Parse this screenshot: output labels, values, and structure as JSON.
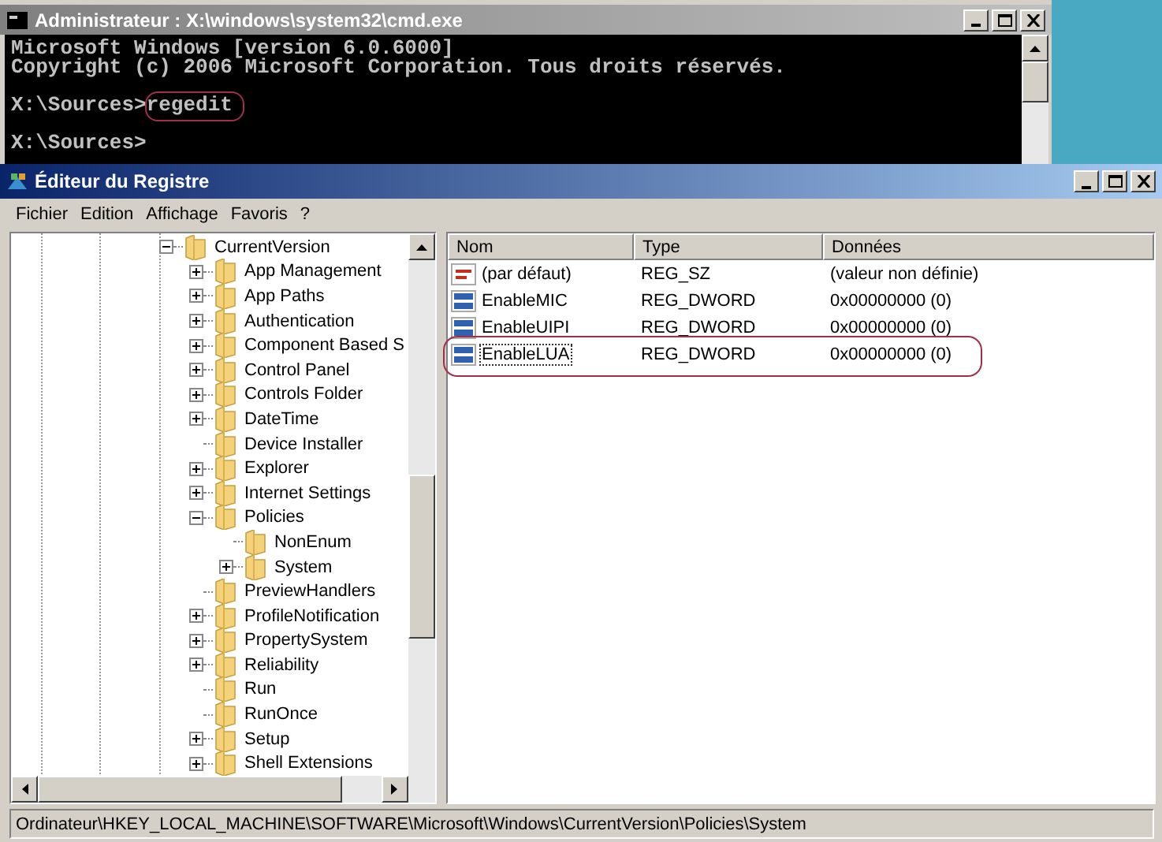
{
  "console_window": {
    "title": "Administrateur : X:\\windows\\system32\\cmd.exe",
    "active": false,
    "lines": [
      {
        "text": "Microsoft Windows [version 6.0.6000]",
        "gap_before": false
      },
      {
        "text": "Copyright (c) 2006 Microsoft Corporation. Tous droits réservés.",
        "gap_before": false
      },
      {
        "text": "X:\\Sources>",
        "command": "regedit",
        "circled": true,
        "gap_before": true
      },
      {
        "text": "X:\\Sources>",
        "gap_before": true
      }
    ]
  },
  "registry_window": {
    "title": "Éditeur du Registre",
    "active": true,
    "menu": [
      "Fichier",
      "Edition",
      "Affichage",
      "Favoris",
      "?"
    ],
    "tree": [
      {
        "label": "CurrentVersion",
        "expandable": true,
        "children": [
          {
            "label": "App Management",
            "expandable": true
          },
          {
            "label": "App Paths",
            "expandable": true
          },
          {
            "label": "Authentication",
            "expandable": true
          },
          {
            "label": "Component Based S",
            "expandable": true
          },
          {
            "label": "Control Panel",
            "expandable": true
          },
          {
            "label": "Controls Folder",
            "expandable": true
          },
          {
            "label": "DateTime",
            "expandable": true
          },
          {
            "label": "Device Installer",
            "expandable": false
          },
          {
            "label": "Explorer",
            "expandable": true
          },
          {
            "label": "Internet Settings",
            "expandable": true
          },
          {
            "label": "Policies",
            "expandable": true,
            "children": [
              {
                "label": "NonEnum",
                "expandable": false
              },
              {
                "label": "System",
                "expandable": true
              }
            ]
          },
          {
            "label": "PreviewHandlers",
            "expandable": false
          },
          {
            "label": "ProfileNotification",
            "expandable": true
          },
          {
            "label": "PropertySystem",
            "expandable": true
          },
          {
            "label": "Reliability",
            "expandable": true
          },
          {
            "label": "Run",
            "expandable": false
          },
          {
            "label": "RunOnce",
            "expandable": false
          },
          {
            "label": "Setup",
            "expandable": true
          },
          {
            "label": "Shell Extensions",
            "expandable": true
          }
        ]
      }
    ],
    "columns": [
      "Nom",
      "Type",
      "Données"
    ],
    "values": [
      {
        "kind": "string",
        "name": "(par défaut)",
        "type": "REG_SZ",
        "data": "(valeur non définie)",
        "focused": false,
        "circled": false
      },
      {
        "kind": "dword",
        "name": "EnableMIC",
        "type": "REG_DWORD",
        "data": "0x00000000 (0)",
        "focused": false,
        "circled": false
      },
      {
        "kind": "dword",
        "name": "EnableUIPI",
        "type": "REG_DWORD",
        "data": "0x00000000 (0)",
        "focused": false,
        "circled": false
      },
      {
        "kind": "dword",
        "name": "EnableLUA",
        "type": "REG_DWORD",
        "data": "0x00000000 (0)",
        "focused": true,
        "circled": true
      }
    ],
    "status_bar": "Ordinateur\\HKEY_LOCAL_MACHINE\\SOFTWARE\\Microsoft\\Windows\\CurrentVersion\\Policies\\System"
  }
}
